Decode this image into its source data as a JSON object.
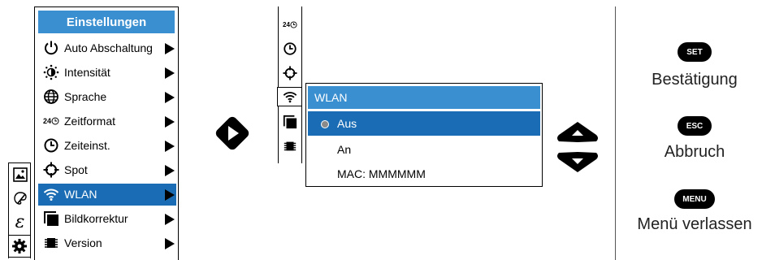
{
  "tabs": [
    {
      "icon": "image-icon"
    },
    {
      "icon": "palette-icon"
    },
    {
      "icon": "emissivity-icon",
      "glyph": "ε"
    },
    {
      "icon": "gear-icon",
      "selected": true
    }
  ],
  "menu": {
    "title": "Einstellungen",
    "items": [
      {
        "label": "Auto Abschaltung",
        "icon": "power-icon"
      },
      {
        "label": "Intensität",
        "icon": "brightness-icon"
      },
      {
        "label": "Sprache",
        "icon": "globe-icon"
      },
      {
        "label": "Zeitformat",
        "icon": "time-format-icon",
        "icon_text": "24"
      },
      {
        "label": "Zeiteinst.",
        "icon": "clock-icon"
      },
      {
        "label": "Spot",
        "icon": "crosshair-icon"
      },
      {
        "label": "WLAN",
        "icon": "wifi-icon",
        "selected": true
      },
      {
        "label": "Bildkorrektur",
        "icon": "image-correction-icon"
      },
      {
        "label": "Version",
        "icon": "chip-icon"
      }
    ]
  },
  "submenu_icons": [
    {
      "icon": "time-format-icon",
      "icon_text": "24"
    },
    {
      "icon": "clock-icon"
    },
    {
      "icon": "crosshair-icon"
    },
    {
      "icon": "wifi-icon",
      "selected": true
    },
    {
      "icon": "image-correction-icon"
    },
    {
      "icon": "chip-icon"
    }
  ],
  "wlan_popup": {
    "title": "WLAN",
    "options": [
      {
        "label": "Aus",
        "selected": true
      },
      {
        "label": "An"
      },
      {
        "label": "MAC: MMMMMM"
      }
    ]
  },
  "legend": [
    {
      "key": "SET",
      "text": "Bestätigung"
    },
    {
      "key": "ESC",
      "text": "Abbruch"
    },
    {
      "key": "MENU",
      "text": "Menü verlassen"
    }
  ],
  "colors": {
    "title_blue": "#3a8fd0",
    "selected_blue": "#1a6db4",
    "black": "#000000"
  }
}
